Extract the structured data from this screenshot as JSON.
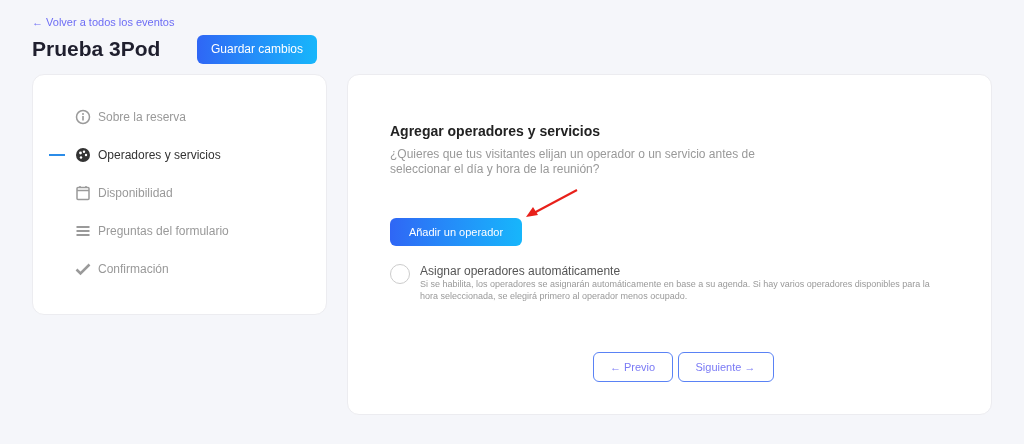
{
  "back_link": "← Volver a todos los eventos",
  "title": "Prueba 3Pod",
  "save_button": "Guardar cambios",
  "steps": [
    {
      "kind": "info",
      "label": "Sobre la reserva",
      "selected": false
    },
    {
      "kind": "palette",
      "label": "Operadores y servicios",
      "selected": true
    },
    {
      "kind": "calendar",
      "label": "Disponibilidad",
      "selected": false
    },
    {
      "kind": "form",
      "label": "Preguntas del formulario",
      "selected": false
    },
    {
      "kind": "check",
      "label": "Confirmación",
      "selected": false
    }
  ],
  "section": {
    "heading": "Agregar operadores y servicios",
    "description": "¿Quieres que tus visitantes elijan un operador o un servicio antes de seleccionar el día y hora de la reunión?",
    "add_button": "Añadir un operador",
    "auto_assign": {
      "label": "Asignar operadores automáticamente",
      "checked": false,
      "help": "Si se habilita, los operadores se asignarán automáticamente en base a su agenda. Si hay varios operadores disponibles para la hora seleccionada, se elegirá primero al operador menos ocupado."
    }
  },
  "nav": {
    "previous": "← Previo",
    "next": "Siguiente →"
  }
}
